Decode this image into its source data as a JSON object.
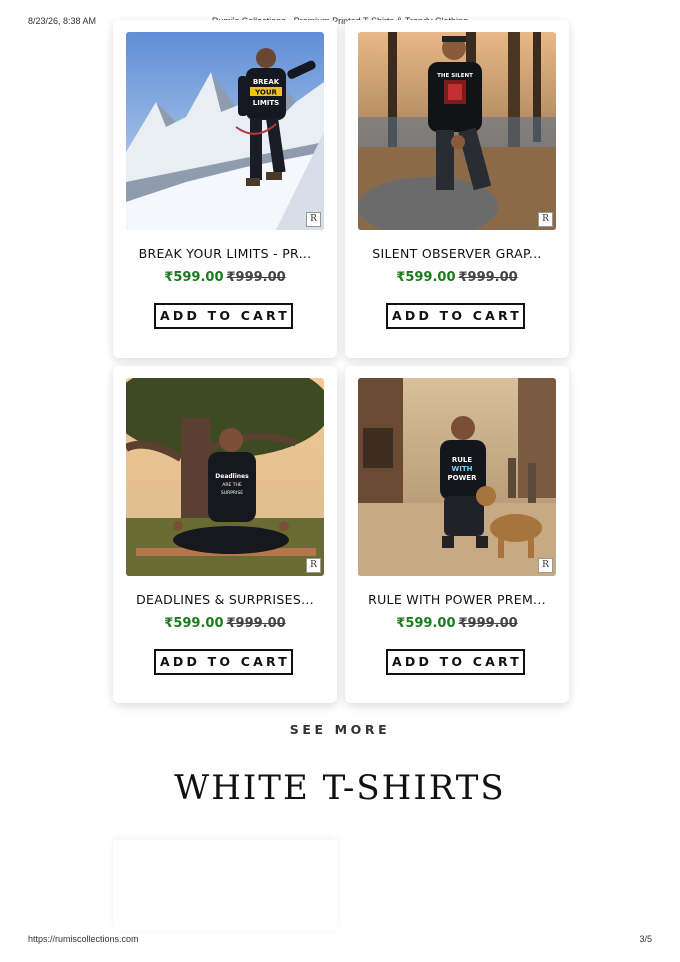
{
  "print_header": {
    "date": "8/23/26, 8:38 AM",
    "title": "Rumi's Collections - Premium Printed T-Shirts & Trendy Clothing"
  },
  "print_footer": {
    "url": "https://rumiscollections.com",
    "page": "3/5"
  },
  "products": [
    {
      "name": "BREAK YOUR LIMITS - PR...",
      "sale_price": "₹599.00",
      "original_price": "₹999.00",
      "cart_label": "ADD TO CART",
      "logo": "R"
    },
    {
      "name": "SILENT OBSERVER GRAP...",
      "sale_price": "₹599.00",
      "original_price": "₹999.00",
      "cart_label": "ADD TO CART",
      "logo": "R"
    },
    {
      "name": "DEADLINES & SURPRISES...",
      "sale_price": "₹599.00",
      "original_price": "₹999.00",
      "cart_label": "ADD TO CART",
      "logo": "R"
    },
    {
      "name": "RULE WITH POWER PREM...",
      "sale_price": "₹599.00",
      "original_price": "₹999.00",
      "cart_label": "ADD TO CART",
      "logo": "R"
    }
  ],
  "shirt_prints": {
    "p0": [
      "BREAK",
      "YOUR",
      "LIMITS"
    ],
    "p1": [
      "THE SILENT"
    ],
    "p2": [
      "Deadlines",
      "ARE THE",
      "SURPRISE"
    ],
    "p3": [
      "RULE",
      "WITH",
      "POWER"
    ]
  },
  "see_more_label": "SEE MORE",
  "section_title": "WHITE T-SHIRTS",
  "colors": {
    "sale_price": "#1c7a1c",
    "button_border": "#111111"
  }
}
